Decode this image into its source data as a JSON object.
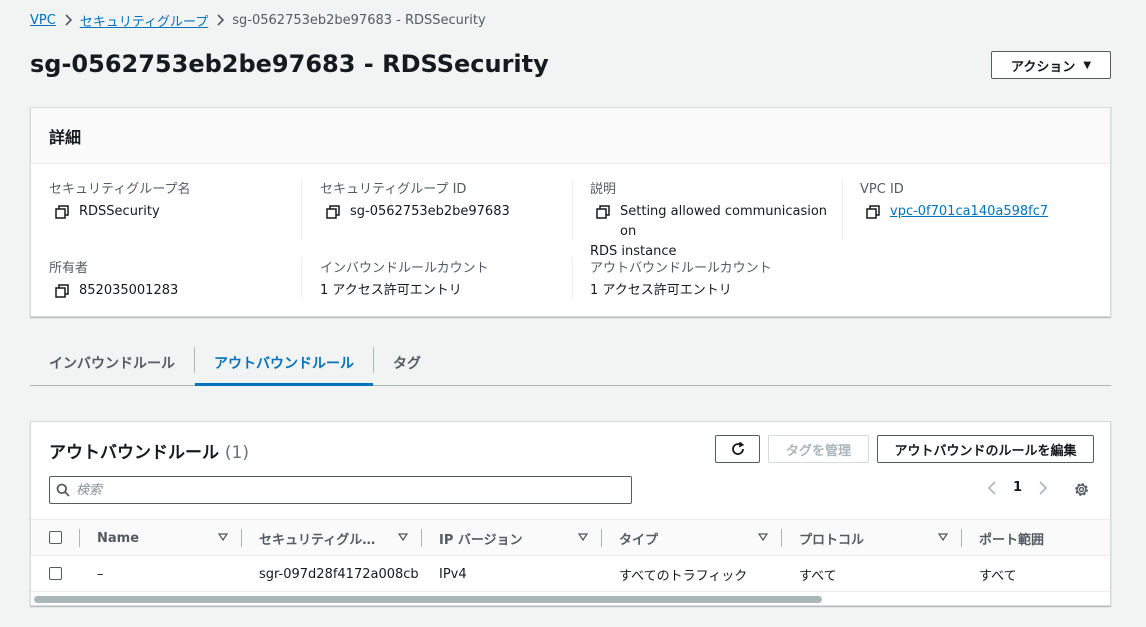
{
  "breadcrumb": {
    "vpc": "VPC",
    "security_groups": "セキュリティグループ",
    "current": "sg-0562753eb2be97683 - RDSSecurity"
  },
  "header": {
    "title": "sg-0562753eb2be97683 - RDSSecurity",
    "action_label": "アクション"
  },
  "details": {
    "title": "詳細",
    "sg_name_label": "セキュリティグループ名",
    "sg_name_value": "RDSSecurity",
    "sg_id_label": "セキュリティグループ ID",
    "sg_id_value": "sg-0562753eb2be97683",
    "description_label": "説明",
    "description_line1": "Setting allowed communicasion on",
    "description_line2": "RDS instance",
    "vpc_id_label": "VPC ID",
    "vpc_id_value": "vpc-0f701ca140a598fc7",
    "owner_label": "所有者",
    "owner_value": "852035001283",
    "inbound_count_label": "インバウンドルールカウント",
    "inbound_count_value": "1 アクセス許可エントリ",
    "outbound_count_label": "アウトバウンドルールカウント",
    "outbound_count_value": "1 アクセス許可エントリ"
  },
  "tabs": [
    {
      "label": "インバウンドルール",
      "active": false
    },
    {
      "label": "アウトバウンドルール",
      "active": true
    },
    {
      "label": "タグ",
      "active": false
    }
  ],
  "rules": {
    "title": "アウトバウンドルール",
    "count": "(1)",
    "manage_tags_label": "タグを管理",
    "edit_rules_label": "アウトバウンドのルールを編集",
    "search_placeholder": "検索",
    "page": "1",
    "columns": [
      "Name",
      "セキュリティグル…",
      "IP バージョン",
      "タイプ",
      "プロトコル",
      "ポート範囲"
    ],
    "rows": [
      {
        "name": "–",
        "rule_id": "sgr-097d28f4172a008cb",
        "ip_version": "IPv4",
        "type": "すべてのトラフィック",
        "protocol": "すべて",
        "port_range": "すべて"
      }
    ]
  },
  "colors": {
    "link": "#0073bb",
    "background": "#f2f3f3",
    "border_dark": "#545b64"
  }
}
